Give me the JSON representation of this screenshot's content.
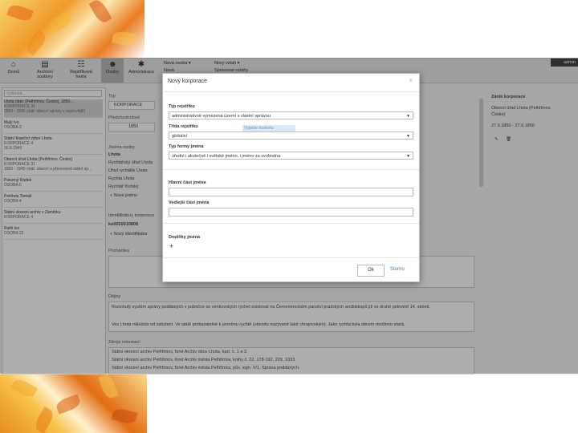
{
  "toolbar": {
    "items": [
      {
        "label": "Domů"
      },
      {
        "label": "Archivní soubory"
      },
      {
        "label": "Rejstříková hesla"
      },
      {
        "label": "Osoby"
      },
      {
        "label": "Administrace"
      }
    ],
    "menu_new": "Nová osoba ▾",
    "menu_new_sub": "Nová",
    "menu_link": "Nový vztah ▾",
    "menu_link_sub": "Spravovat vztahy",
    "admin": "admin"
  },
  "left_panel": {
    "search_placeholder": "Vyhledat...",
    "items": [
      {
        "title": "Lhota obec (Pelhřimov, Česko), 1850-...",
        "line2": "KORPORACE 31",
        "line3": "1850 - 1945 (stát: obecní správy v nejnovější)",
        "selected": true
      },
      {
        "title": "Malý Ivo",
        "line2": "OSOBA 3",
        "line3": "",
        "selected": false
      },
      {
        "title": "Státní finanční výbor Lhota",
        "line2": "KORPORACE 4",
        "line3": "30.8.1945",
        "selected": false
      },
      {
        "title": "Obecní úřad Lhota (Pelhřimov, Česko)",
        "line2": "KORPORACE 31",
        "line3": "1850 - 1945 (stát: obecní a přenesená státní sp...",
        "selected": false
      },
      {
        "title": "Pokorný Radek",
        "line2": "OSOBA 5",
        "line3": "",
        "selected": false
      },
      {
        "title": "Petržela Tomáš",
        "line2": "OSOBA 4",
        "line3": "",
        "selected": false
      },
      {
        "title": "Státní okresní archiv v Záměrku",
        "line2": "KORPORACE 4",
        "line3": "",
        "selected": false
      },
      {
        "title": "Ruliš Ivo",
        "line2": "OSOBA 22",
        "line3": "",
        "selected": false
      }
    ]
  },
  "center": {
    "type_label": "Typ",
    "type_value": "KORPORACE",
    "existence_label": "Předchodnobod",
    "existence_value": "1850",
    "names_label": "Jména osoby",
    "names": [
      "Lhota",
      "Rychtářský úřad Lhota",
      "Úřad rychtáře Lhota",
      "Rychta Lhota",
      "Rychtář lhotský"
    ],
    "add_name": "+ Nové jméno",
    "ident_label": "Identifikátory korporace",
    "ident_value": "ko0020010808",
    "add_ident": "+ Nový identifikátor",
    "note_label": "Poznámka",
    "history_label": "Dějiny",
    "history_lines": [
      "Rozvinutý systém správy poddaných v pobočce se venkovských rychet existoval na Červenoreckém panství pražských arcibiskupů již ve druhé polovině 14. století.",
      "Ves Lhota náležela od založení. Ve státě prokazatelně k prvnímu rychtě (obvodu nazývané také chrajovským). Jako rychta byla obcem mníšeno stará."
    ],
    "sources_label": "Zdroje informací",
    "sources_lines": [
      "Státní okresní archiv Pelhřimov, fond Archiv obce Lhota, kart. č. 1 a 2.",
      "Státní okresní archiv Pelhřimov, fond Archiv města Pelhřimov, knihy č. 22, 178-192, 229, 1033.",
      "Státní okresní archiv Pelhřimov, fond Archiv města Pelhřimov, pův. sign. V/1, Správa poddaných."
    ]
  },
  "right_panel": {
    "title": "Zánik korporace",
    "name": "Obecní úřad Lhota (Pelhřimov, Česko)",
    "dates": "27.9.1850 - 27.9.1850"
  },
  "modal": {
    "title": "Nový korporace",
    "close": "×",
    "type_label": "Typ rejstříku",
    "type_value": "administrativně vymezená území s vlastní správou",
    "class_label": "Třída rejstříku",
    "class_value": "globální",
    "dropdown_hint": "Vyberte hodnotu",
    "form_label": "Typ formy jména",
    "form_value": "úřední i akutečně i světské jméno, i jméno za svobodna",
    "main_part_label": "Hlavní část jména",
    "side_part_label": "Vedlejší část jména",
    "extras_label": "Doplňky jména",
    "add_extra": "+",
    "ok": "Ok",
    "cancel": "Storno"
  }
}
